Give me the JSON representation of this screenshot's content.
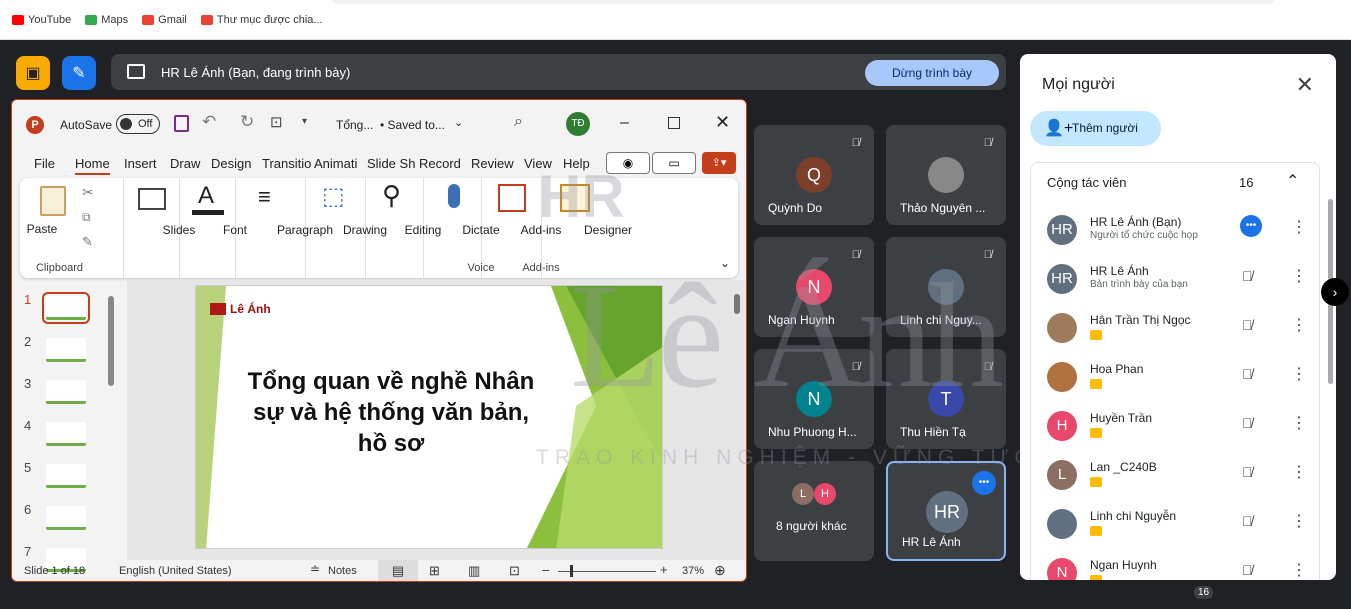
{
  "bookmarks": [
    {
      "label": "YouTube",
      "color": "#ff0000"
    },
    {
      "label": "Maps",
      "color": "#34a853"
    },
    {
      "label": "Gmail",
      "color": "#ea4335"
    },
    {
      "label": "Thư mục được chia...",
      "color": "#ea4335"
    }
  ],
  "presenting_bar": {
    "text": "HR Lê Ánh (Bạn, đang trình bày)",
    "stop_label": "Dừng trình bày"
  },
  "tiles": [
    {
      "name": "Quỳnh Do",
      "initial": "Q",
      "color": "#7b3f2a"
    },
    {
      "name": "Thảo Nguyên ...",
      "initial": "",
      "color": "#888"
    },
    {
      "name": "Ngan Huynh",
      "initial": "N",
      "color": "#e8496b"
    },
    {
      "name": "Linh chi Nguy...",
      "initial": "",
      "color": "#607080"
    },
    {
      "name": "Nhu Phuong H...",
      "initial": "N",
      "color": "#00838f"
    },
    {
      "name": "Thu Hiền Tạ",
      "initial": "T",
      "color": "#3949ab"
    },
    {
      "name": "8 người khác",
      "initial": "L",
      "color": "#8d6e63"
    },
    {
      "name": "HR Lê Ánh",
      "initial": "HR",
      "color": "#607080"
    }
  ],
  "ppt": {
    "autosave": "AutoSave",
    "autosave_state": "Off",
    "doc_title": "Tổng...",
    "saved": "• Saved to...",
    "user_initials": "TĐ",
    "menu": [
      "File",
      "Home",
      "Insert",
      "Draw",
      "Design",
      "Transitio",
      "Animati",
      "Slide Sh",
      "Record",
      "Review",
      "View",
      "Help"
    ],
    "ribbon": {
      "paste": "Paste",
      "clipboard": "Clipboard",
      "slides": "Slides",
      "font": "Font",
      "paragraph": "Paragraph",
      "drawing": "Drawing",
      "editing": "Editing",
      "dictate": "Dictate",
      "voice": "Voice",
      "addins": "Add-ins",
      "addins_group": "Add-ins",
      "designer": "Designer"
    },
    "slide_numbers": [
      "1",
      "2",
      "3",
      "4",
      "5",
      "6",
      "7"
    ],
    "slide_logo": "Lê Ánh",
    "slide_title": "Tổng quan về nghề Nhân sự và hệ thống văn bản, hồ sơ",
    "status": {
      "slide": "Slide 1 of 18",
      "lang": "English (United States)",
      "notes": "Notes",
      "zoom": "37%"
    }
  },
  "watermark": {
    "hr": "HR",
    "name": "Lê Ánh",
    "tagline": "TRAO KINH NGHIỆM - VỮNG TƯƠNG LAI"
  },
  "panel": {
    "title": "Mọi người",
    "add_label": "Thêm người",
    "section": "Cộng tác viên",
    "count": "16",
    "people": [
      {
        "name": "HR Lê Ánh (Bạn)",
        "sub": "Người tổ chức cuộc họp",
        "initial": "HR",
        "color": "#607080",
        "active": true
      },
      {
        "name": "HR Lê Ánh",
        "sub": "Bản trình bày của bạn",
        "initial": "HR",
        "color": "#607080",
        "active": false
      },
      {
        "name": "Hân Trần Thị Ngọc",
        "sub": "",
        "initial": "",
        "color": "#9e7b5c",
        "active": false
      },
      {
        "name": "Hoa Phan",
        "sub": "",
        "initial": "",
        "color": "#b07040",
        "active": false
      },
      {
        "name": "Huyền Trần",
        "sub": "",
        "initial": "H",
        "color": "#e8496b",
        "active": false
      },
      {
        "name": "Lan _C240B",
        "sub": "",
        "initial": "L",
        "color": "#8d6e63",
        "active": false
      },
      {
        "name": "Linh chi Nguyễn",
        "sub": "",
        "initial": "",
        "color": "#607080",
        "active": false
      },
      {
        "name": "Ngan Huynh",
        "sub": "",
        "initial": "N",
        "color": "#e8496b",
        "active": false
      }
    ]
  },
  "bottom_badge": "16"
}
